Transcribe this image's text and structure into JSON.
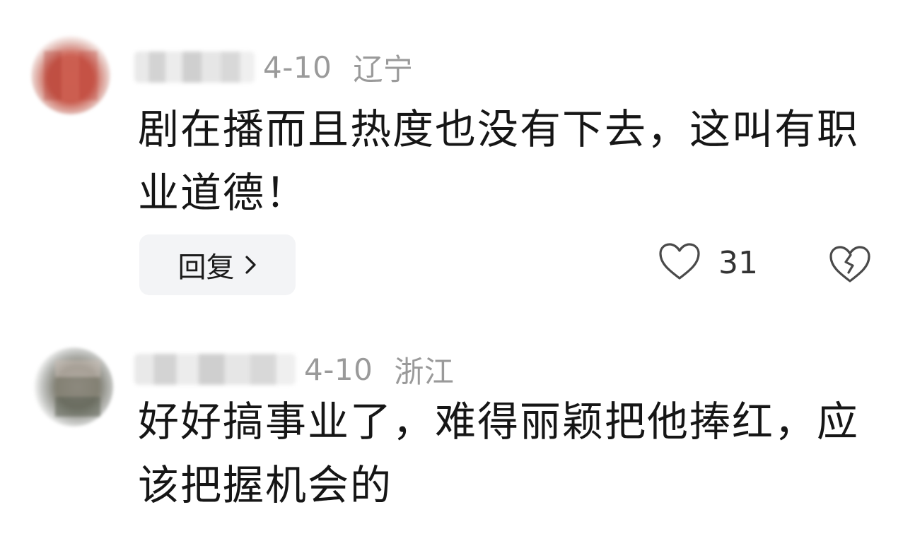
{
  "comments": [
    {
      "date": "4-10",
      "location": "辽宁",
      "text": "剧在播而且热度也没有下去，这叫有职业道德！",
      "reply_label": "回复",
      "like_count": "31"
    },
    {
      "date": "4-10",
      "location": "浙江",
      "text": "好好搞事业了，难得丽颖把他捧红，应该把握机会的"
    }
  ],
  "icons": {
    "like": "heart-outline-icon",
    "dislike": "broken-heart-icon",
    "reply_chevron": "chevron-right-icon"
  },
  "colors": {
    "meta_gray": "#9a9a9a",
    "reply_bg": "#f3f4f6",
    "text": "#161616"
  }
}
